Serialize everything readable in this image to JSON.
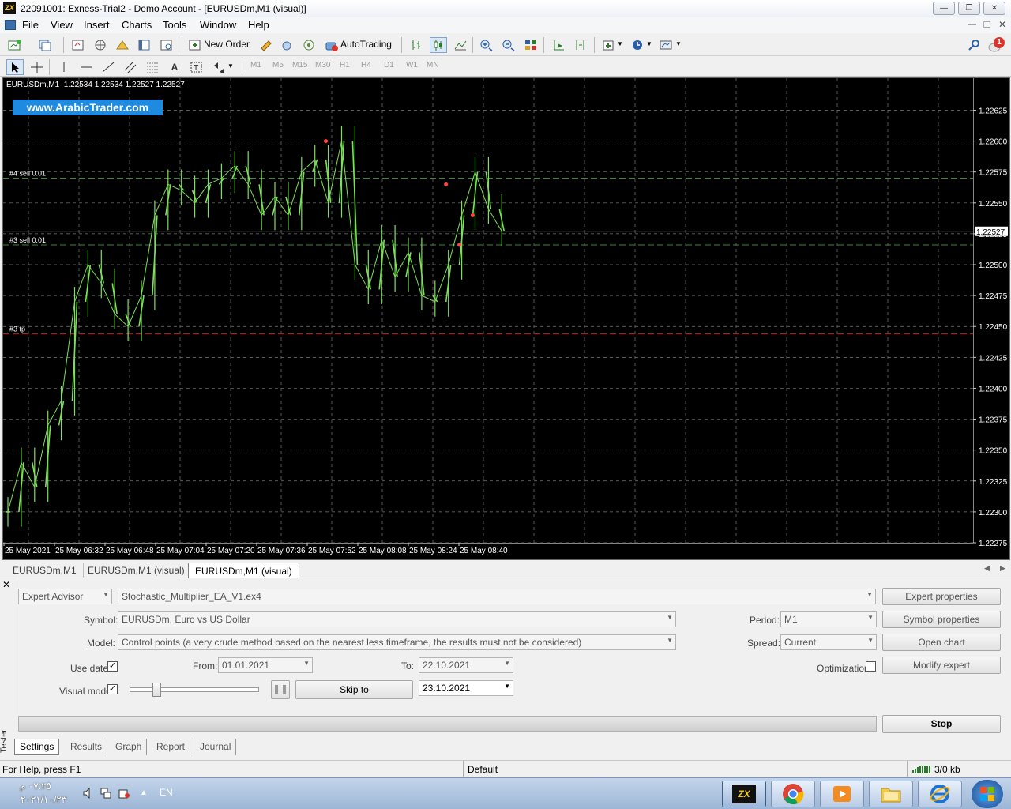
{
  "window": {
    "title": "22091001: Exness-Trial2 - Demo Account - [EURUSDm,M1 (visual)]"
  },
  "menu": [
    "File",
    "View",
    "Insert",
    "Charts",
    "Tools",
    "Window",
    "Help"
  ],
  "toolbar": {
    "new_order": "New Order",
    "auto_trading": "AutoTrading",
    "notification_count": "1"
  },
  "timeframes": [
    "M1",
    "M5",
    "M15",
    "M30",
    "H1",
    "H4",
    "D1",
    "W1",
    "MN"
  ],
  "chart": {
    "header": "EURUSDm,M1  1.22534 1.22534 1.22527 1.22527",
    "watermark": "www.ArabicTrader.com",
    "current_price": "1.22527",
    "order_lines": [
      {
        "label": "#4 sell 0.01",
        "price": 1.2257,
        "color": "#3a8a3a"
      },
      {
        "label": "#3 sell 0.01",
        "price": 1.22516,
        "color": "#3a8a3a"
      },
      {
        "label": "#3 tp",
        "price": 1.22444,
        "color": "#c02020"
      }
    ],
    "price_labels": [
      "1.22625",
      "1.22600",
      "1.22575",
      "1.22550",
      "1.22525",
      "1.22500",
      "1.22475",
      "1.22450",
      "1.22425",
      "1.22400",
      "1.22375",
      "1.22350",
      "1.22325",
      "1.22300",
      "1.22275"
    ],
    "time_labels": [
      "25 May 2021",
      "25 May 06:32",
      "25 May 06:48",
      "25 May 07:04",
      "25 May 07:20",
      "25 May 07:36",
      "25 May 07:52",
      "25 May 08:08",
      "25 May 08:24",
      "25 May 08:40"
    ]
  },
  "chart_data": {
    "type": "line",
    "title": "EURUSDm,M1",
    "xlabel": "",
    "ylabel": "",
    "ylim": [
      1.22275,
      1.2264
    ],
    "grid": true,
    "x": [
      "06:16",
      "06:20",
      "06:24",
      "06:28",
      "06:32",
      "06:36",
      "06:40",
      "06:44",
      "06:48",
      "06:52",
      "06:56",
      "07:00",
      "07:04",
      "07:08",
      "07:12",
      "07:16",
      "07:20",
      "07:24",
      "07:28",
      "07:32",
      "07:36",
      "07:40",
      "07:44",
      "07:48",
      "07:52",
      "07:56",
      "08:00",
      "08:04",
      "08:08",
      "08:12",
      "08:16",
      "08:20",
      "08:24",
      "08:28",
      "08:32",
      "08:36",
      "08:40",
      "08:44"
    ],
    "series": [
      {
        "name": "EURUSDm,M1",
        "values": [
          1.223,
          1.2234,
          1.2232,
          1.2237,
          1.2239,
          1.2247,
          1.225,
          1.22485,
          1.2246,
          1.2245,
          1.22475,
          1.2254,
          1.22565,
          1.2256,
          1.2255,
          1.22565,
          1.2257,
          1.2258,
          1.22565,
          1.2254,
          1.22555,
          1.2254,
          1.22575,
          1.22585,
          1.2255,
          1.226,
          1.225,
          1.2248,
          1.2252,
          1.2249,
          1.2251,
          1.22475,
          1.2247,
          1.225,
          1.2254,
          1.22575,
          1.22545,
          1.22527
        ]
      }
    ]
  },
  "chart_tabs": [
    "EURUSDm,M1",
    "EURUSDm,M1 (visual)",
    "EURUSDm,M1 (visual)"
  ],
  "tester": {
    "side_label": "Tester",
    "type": "Expert Advisor",
    "expert": "Stochastic_Multiplier_EA_V1.ex4",
    "symbol_label": "Symbol:",
    "symbol": "EURUSDm, Euro vs US Dollar",
    "model_label": "Model:",
    "model": "Control points (a very crude method based on the nearest less timeframe, the results must not be considered)",
    "period_label": "Period:",
    "period": "M1",
    "spread_label": "Spread:",
    "spread": "Current",
    "use_date_label": "Use date",
    "from_label": "From:",
    "from": "01.01.2021",
    "to_label": "To:",
    "to": "22.10.2021",
    "optimization_label": "Optimization",
    "visual_mode_label": "Visual mode",
    "skip_to": "Skip to",
    "skip_date": "23.10.2021",
    "buttons": {
      "expert_properties": "Expert properties",
      "symbol_properties": "Symbol properties",
      "open_chart": "Open chart",
      "modify_expert": "Modify expert",
      "stop": "Stop"
    },
    "tabs": [
      "Settings",
      "Results",
      "Graph",
      "Report",
      "Journal"
    ]
  },
  "status": {
    "help": "For Help, press F1",
    "profile": "Default",
    "traffic": "3/0 kb"
  },
  "taskbar": {
    "time": "٠٧:٢٥ م",
    "date": "٢٠٢١/١٠/٢٣",
    "lang": "EN"
  }
}
